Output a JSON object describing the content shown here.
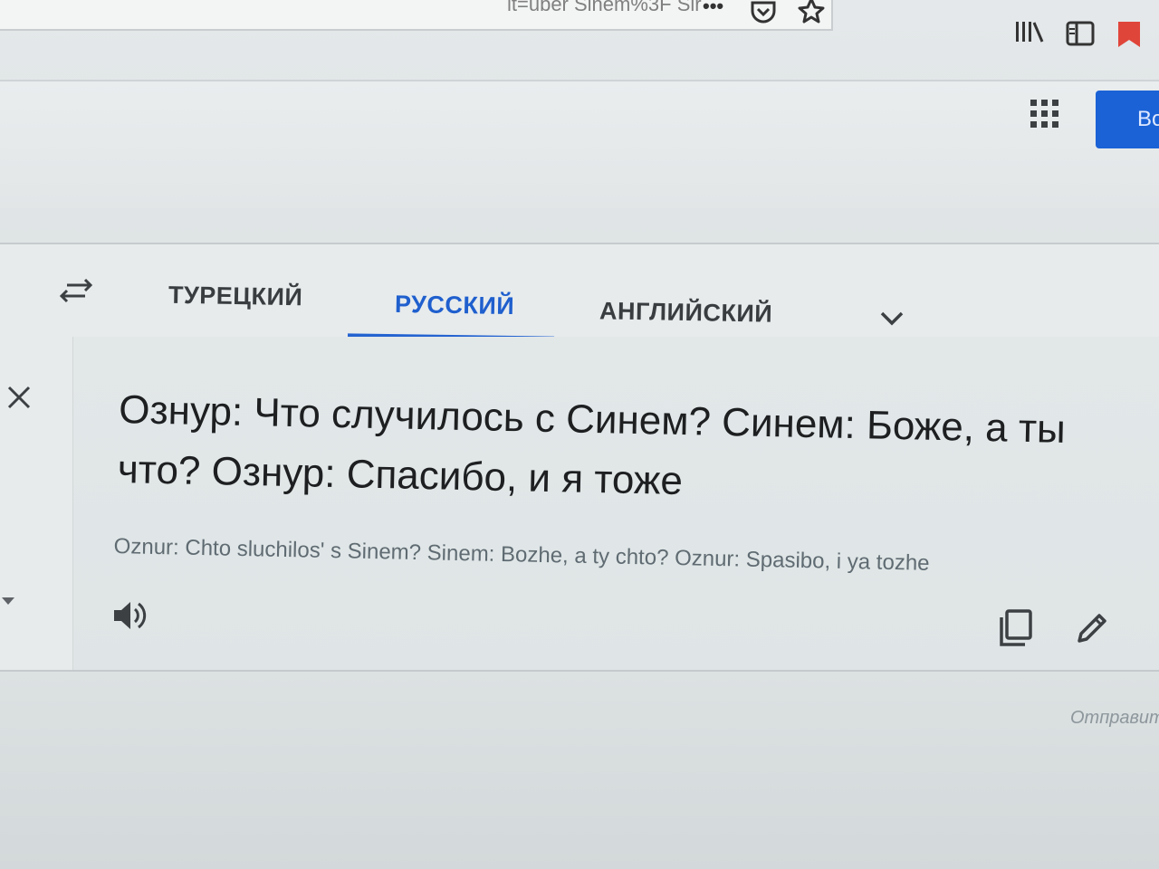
{
  "browser": {
    "url_fragment": "lt=uber Sinem%3F Sir",
    "menu_label": "•••",
    "icons": [
      "pocket-icon",
      "star-icon",
      "library-icon",
      "sidebar-icon",
      "bookmark-icon"
    ],
    "bookmark_color": "#e0453a"
  },
  "header": {
    "login_button_label": "Во",
    "apps_icon": "apps-grid-icon",
    "accent_color": "#1b62d6"
  },
  "languages": {
    "tabs": [
      {
        "label": "ТУРЕЦКИЙ",
        "active": false
      },
      {
        "label": "РУССКИЙ",
        "active": true
      },
      {
        "label": "АНГЛИЙСКИЙ",
        "active": false
      }
    ],
    "active_color": "#1f5fce"
  },
  "output": {
    "translation": "Ознур: Что случилось с Синем? Синем: Боже, а ты что? Ознур: Спасибо, и я тоже",
    "transliteration": "Oznur: Chto sluchilos' s Sinem? Sinem: Bozhe, a ty chto? Oznur: Spasibo, i ya tozhe"
  },
  "footer": {
    "send_feedback": "Отправить"
  }
}
